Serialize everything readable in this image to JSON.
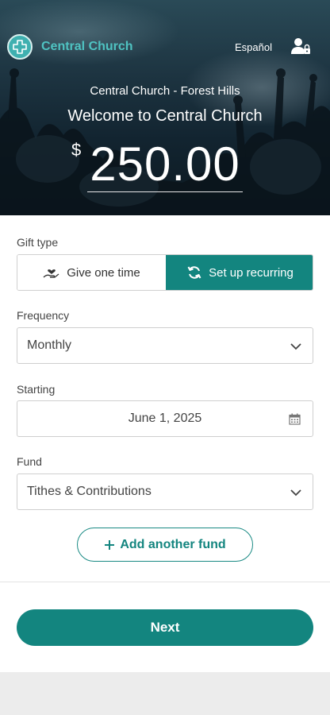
{
  "header": {
    "brand": "Central Church",
    "language_link": "Español",
    "logo_icon": "cross-logo-icon",
    "account_icon": "user-lock-icon",
    "subtitle": "Central Church - Forest Hills",
    "welcome": "Welcome to Central Church",
    "currency_symbol": "$",
    "amount": "250.00"
  },
  "form": {
    "gift_type_label": "Gift type",
    "gift_options": [
      {
        "label": "Give one time",
        "icon": "hand-heart-icon",
        "selected": false
      },
      {
        "label": "Set up recurring",
        "icon": "recurring-arrows-icon",
        "selected": true
      }
    ],
    "frequency_label": "Frequency",
    "frequency_value": "Monthly",
    "starting_label": "Starting",
    "starting_value": "June 1, 2025",
    "fund_label": "Fund",
    "fund_value": "Tithes & Contributions",
    "add_fund_label": "Add another fund"
  },
  "footer": {
    "next_label": "Next"
  },
  "colors": {
    "accent": "#13857f",
    "brand_text": "#4fc3c2"
  }
}
